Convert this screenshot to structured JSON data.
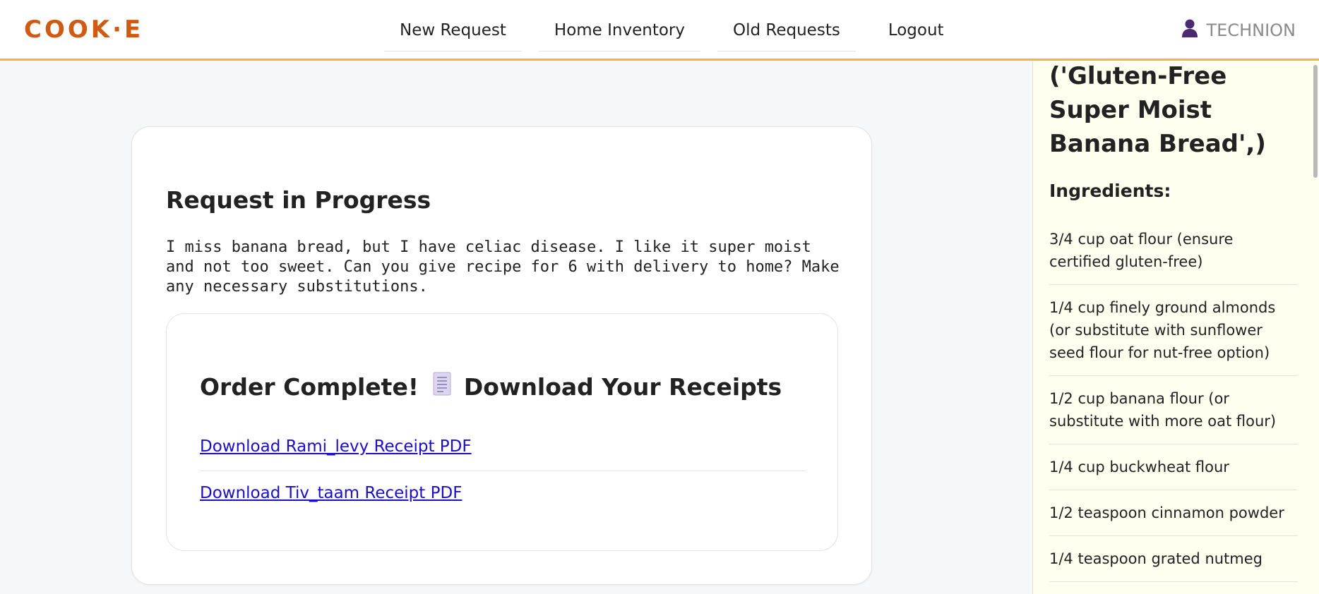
{
  "header": {
    "logo": "COOK·E",
    "nav": [
      {
        "label": "New Request"
      },
      {
        "label": "Home Inventory"
      },
      {
        "label": "Old Requests"
      },
      {
        "label": "Logout"
      }
    ],
    "user": {
      "name": "TECHNION",
      "icon": "user-icon"
    }
  },
  "main": {
    "title": "Request in Progress",
    "request_text": "I miss banana bread, but I have celiac disease. I like it super moist and not too sweet. Can you give recipe for 6 with delivery to home? Make any necessary substitutions.",
    "order": {
      "title_before": "Order Complete!",
      "icon": "receipt-icon",
      "title_after": "Download Your Receipts",
      "links": [
        {
          "label": "Download Rami_levy Receipt PDF"
        },
        {
          "label": "Download Tiv_taam Receipt PDF"
        }
      ]
    }
  },
  "sidebar": {
    "recipe_title": "('Gluten-Free Super Moist Banana Bread',)",
    "ingredients_heading": "Ingredients:",
    "ingredients": [
      "3/4 cup oat flour (ensure certified gluten-free)",
      "1/4 cup finely ground almonds (or substitute with sunflower seed flour for nut-free option)",
      "1/2 cup banana flour (or substitute with more oat flour)",
      "1/4 cup buckwheat flour",
      "1/2 teaspoon cinnamon powder",
      "1/4 teaspoon grated nutmeg"
    ]
  },
  "colors": {
    "accent": "#cf5a13",
    "header_border": "#f5b53a",
    "link": "#1a0dcc",
    "sidebar_bg": "#fffff0"
  }
}
